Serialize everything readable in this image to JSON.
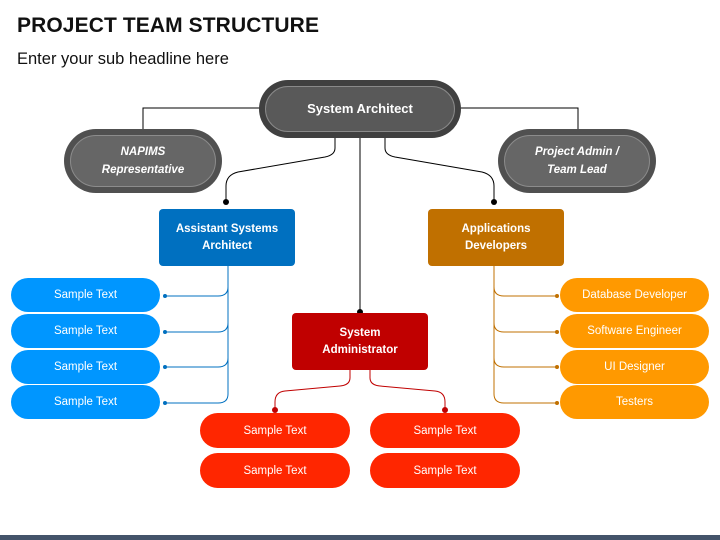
{
  "title": "PROJECT TEAM STRUCTURE",
  "subtitle": "Enter your sub headline here",
  "colors": {
    "dark_node": "#404040",
    "gray_node": "#595959",
    "blue": "#0070c0",
    "blue_light": "#0096ff",
    "orange": "#c07000",
    "orange_light": "#ff9900",
    "red": "#c00000",
    "red_light": "#ff2600",
    "footer": "#44546a"
  },
  "root": {
    "label": "System Architect"
  },
  "advisors": [
    {
      "label_line1": "NAPIMS",
      "label_line2": "Representative"
    },
    {
      "label_line1": "Project Admin /",
      "label_line2": "Team Lead"
    }
  ],
  "branches": {
    "assistant": {
      "label_line1": "Assistant Systems",
      "label_line2": "Architect",
      "items": [
        "Sample Text",
        "Sample Text",
        "Sample Text",
        "Sample Text"
      ]
    },
    "sysadmin": {
      "label_line1": "System",
      "label_line2": "Administrator",
      "left_items": [
        "Sample Text",
        "Sample Text"
      ],
      "right_items": [
        "Sample Text",
        "Sample Text"
      ]
    },
    "developers": {
      "label_line1": "Applications",
      "label_line2": "Developers",
      "items": [
        "Database Developer",
        "Software Engineer",
        "UI Designer",
        "Testers"
      ]
    }
  }
}
